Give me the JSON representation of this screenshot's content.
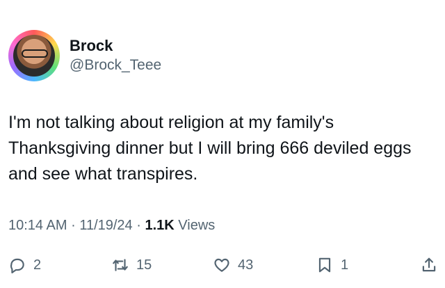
{
  "author": {
    "display_name": "Brock",
    "handle": "@Brock_Teee"
  },
  "tweet": {
    "text": "I'm not talking about religion at my family's Thanksgiving dinner but I will bring 666 deviled eggs and see what transpires."
  },
  "meta": {
    "time": "10:14 AM",
    "date": "11/19/24",
    "separator": "·",
    "views_count": "1.1K",
    "views_label": "Views"
  },
  "actions": {
    "replies": "2",
    "retweets": "15",
    "likes": "43",
    "bookmarks": "1"
  },
  "icons": {
    "reply": "reply-bubble-icon",
    "retweet": "retweet-icon",
    "like": "heart-icon",
    "bookmark": "bookmark-icon",
    "share": "share-icon"
  }
}
